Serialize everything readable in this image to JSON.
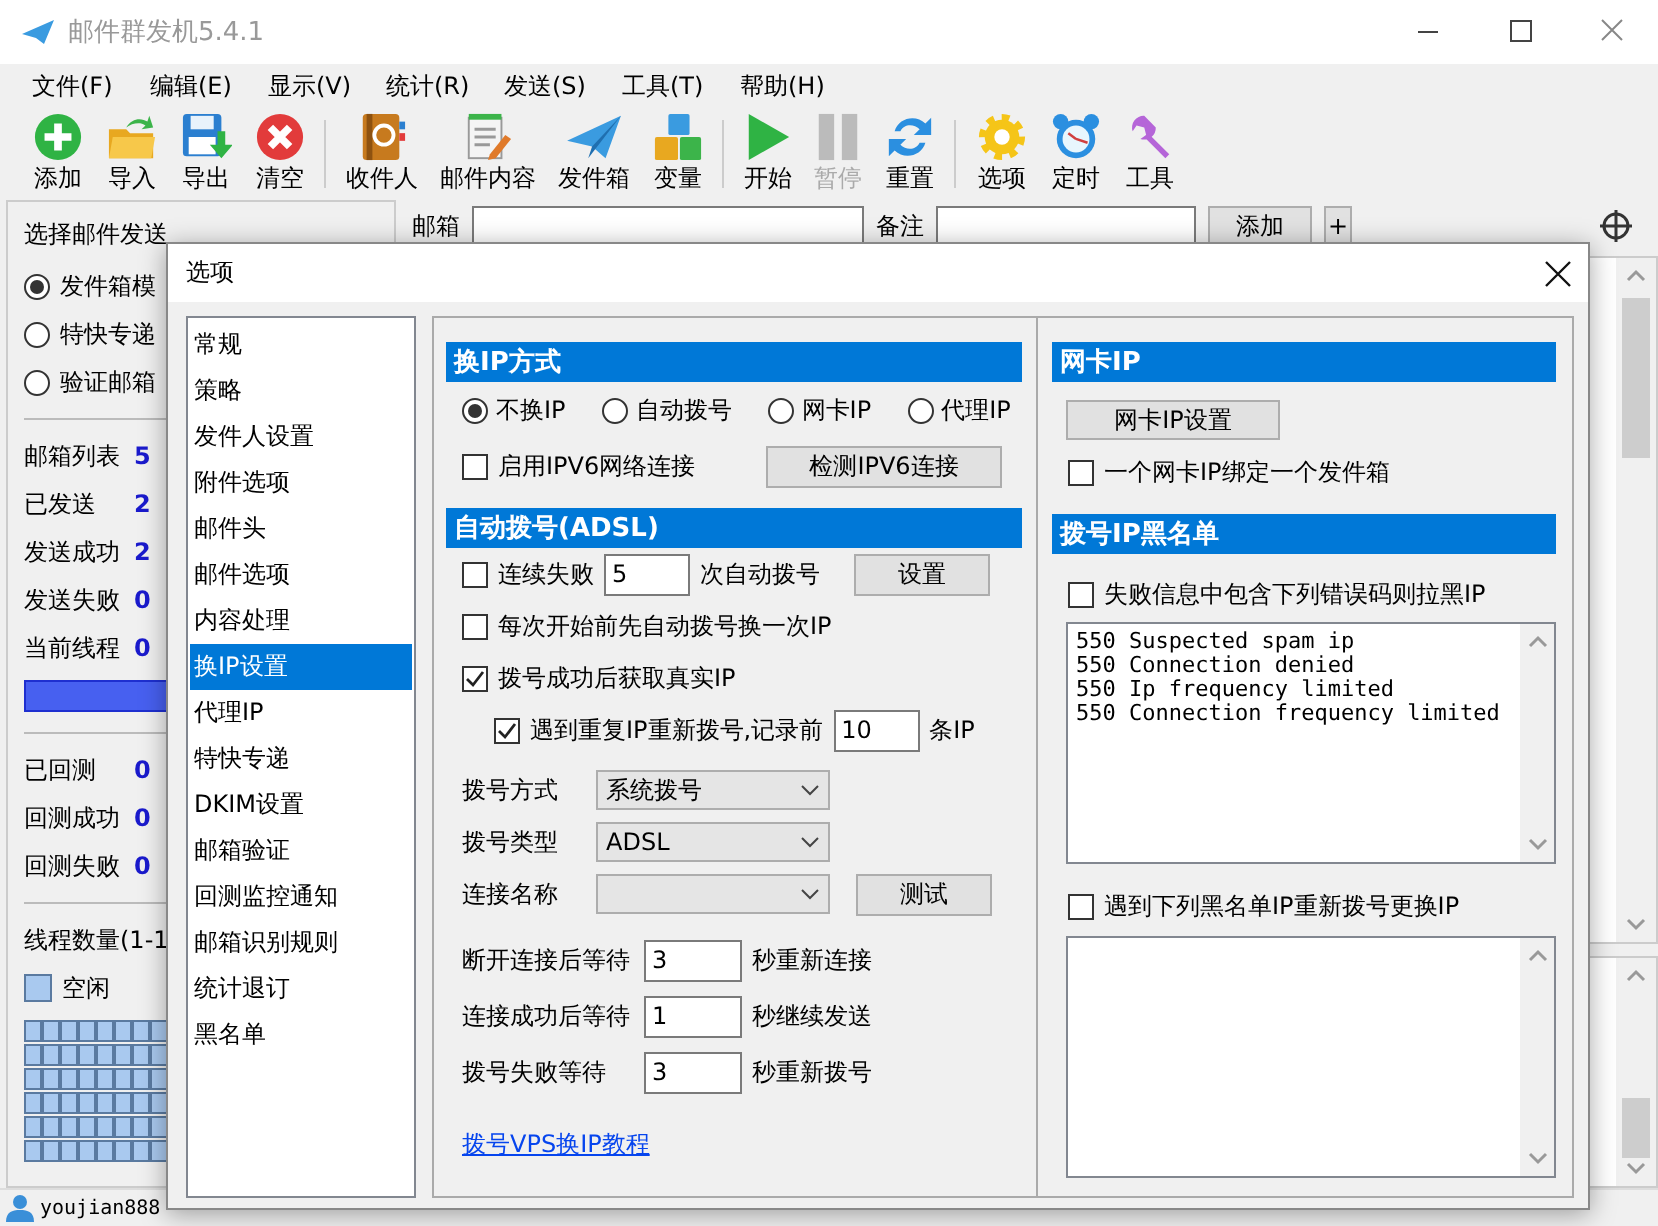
{
  "window": {
    "title": "邮件群发机5.4.1"
  },
  "menu": [
    "文件(F)",
    "编辑(E)",
    "显示(V)",
    "统计(R)",
    "发送(S)",
    "工具(T)",
    "帮助(H)"
  ],
  "toolbar": [
    [
      {
        "kind": "add",
        "label": "添加",
        "disabled": false
      },
      {
        "kind": "import",
        "label": "导入",
        "disabled": false
      },
      {
        "kind": "export",
        "label": "导出",
        "disabled": false
      },
      {
        "kind": "clear",
        "label": "清空",
        "disabled": false
      }
    ],
    [
      {
        "kind": "contacts",
        "label": "收件人",
        "disabled": false
      },
      {
        "kind": "content",
        "label": "邮件内容",
        "disabled": false
      },
      {
        "kind": "outbox",
        "label": "发件箱",
        "disabled": false
      },
      {
        "kind": "variables",
        "label": "变量",
        "disabled": false
      }
    ],
    [
      {
        "kind": "start",
        "label": "开始",
        "disabled": false
      },
      {
        "kind": "pause",
        "label": "暂停",
        "disabled": true
      },
      {
        "kind": "reset",
        "label": "重置",
        "disabled": false
      }
    ],
    [
      {
        "kind": "options",
        "label": "选项",
        "disabled": false
      },
      {
        "kind": "timer",
        "label": "定时",
        "disabled": false
      },
      {
        "kind": "tools",
        "label": "工具",
        "disabled": false
      }
    ]
  ],
  "mode_panel": {
    "heading": "选择邮件发送",
    "modes": [
      {
        "label": "发件箱模",
        "selected": true
      },
      {
        "label": "特快专递",
        "selected": false
      },
      {
        "label": "验证邮箱",
        "selected": false
      }
    ]
  },
  "stats": [
    {
      "label": "邮箱列表",
      "value": "5"
    },
    {
      "label": "已发送",
      "value": "2"
    },
    {
      "label": "发送成功",
      "value": "2"
    },
    {
      "label": "发送失败",
      "value": "0"
    },
    {
      "label": "当前线程",
      "value": "0"
    }
  ],
  "reply_stats": [
    {
      "label": "已回测",
      "value": "0"
    },
    {
      "label": "回测成功",
      "value": "0"
    },
    {
      "label": "回测失败",
      "value": "0"
    }
  ],
  "progress": {
    "level": 1
  },
  "threads": {
    "label": "线程数量(1-1",
    "legend": "空闲"
  },
  "mailbox_bar": {
    "mailbox_label": "邮箱",
    "note_label": "备注",
    "add_button": "添加",
    "plus_button": "+"
  },
  "status_bar": {
    "user": "youjian888"
  },
  "dialog": {
    "title": "选项",
    "nav": [
      {
        "label": "常规",
        "selected": false
      },
      {
        "label": "策略",
        "selected": false
      },
      {
        "label": "发件人设置",
        "selected": false
      },
      {
        "label": "附件选项",
        "selected": false
      },
      {
        "label": "邮件头",
        "selected": false
      },
      {
        "label": "邮件选项",
        "selected": false
      },
      {
        "label": "内容处理",
        "selected": false
      },
      {
        "label": "换IP设置",
        "selected": true
      },
      {
        "label": "代理IP",
        "selected": false
      },
      {
        "label": "特快专递",
        "selected": false
      },
      {
        "label": "DKIM设置",
        "selected": false
      },
      {
        "label": "邮箱验证",
        "selected": false
      },
      {
        "label": "回测监控通知",
        "selected": false
      },
      {
        "label": "邮箱识别规则",
        "selected": false
      },
      {
        "label": "统计退订",
        "selected": false
      },
      {
        "label": "黑名单",
        "selected": false
      }
    ],
    "switch_ip": {
      "title": "换IP方式",
      "modes": [
        {
          "label": "不换IP",
          "selected": true
        },
        {
          "label": "自动拨号",
          "selected": false
        },
        {
          "label": "网卡IP",
          "selected": false
        },
        {
          "label": "代理IP",
          "selected": false
        }
      ],
      "ipv6": {
        "label": "启用IPV6网络连接",
        "checked": false
      },
      "ipv6_button": "检测IPV6连接"
    },
    "adsl": {
      "title": "自动拨号(ADSL)",
      "fail_redial": {
        "label": "连续失败",
        "checked": false,
        "value": "5",
        "suffix": "次自动拨号"
      },
      "settings_button": "设置",
      "redial_before_start": {
        "label": "每次开始前先自动拨号换一次IP",
        "checked": false
      },
      "get_real_ip": {
        "label": "拨号成功后获取真实IP",
        "checked": true
      },
      "redial_on_repeat": {
        "label": "遇到重复IP重新拨号,记录前",
        "checked": true,
        "value": "10",
        "suffix": "条IP"
      },
      "selects": [
        {
          "label": "拨号方式",
          "value": "系统拨号"
        },
        {
          "label": "拨号类型",
          "value": "ADSL"
        },
        {
          "label": "连接名称"
        }
      ],
      "test_button": "测试",
      "waits": [
        {
          "label": "断开连接后等待",
          "value": "3",
          "suffix": "秒重新连接"
        },
        {
          "label": "连接成功后等待",
          "value": "1",
          "suffix": "秒继续发送"
        },
        {
          "label": "拨号失败等待",
          "value": "3",
          "suffix": "秒重新拨号"
        }
      ],
      "tutorial_link": "拨号VPS换IP教程"
    },
    "nic": {
      "title": "网卡IP",
      "settings_button": "网卡IP设置",
      "bind": {
        "label": "一个网卡IP绑定一个发件箱",
        "checked": false
      }
    },
    "blacklist": {
      "title": "拨号IP黑名单",
      "error_codes": {
        "label": "失败信息中包含下列错误码则拉黑IP",
        "checked": false,
        "lines": [
          "550 Suspected spam ip",
          "550 Connection denied",
          "550 Ip frequency limited",
          "550 Connection frequency limited"
        ]
      },
      "redial_blacklisted": {
        "label": "遇到下列黑名单IP重新拨号更换IP",
        "checked": false
      }
    }
  }
}
